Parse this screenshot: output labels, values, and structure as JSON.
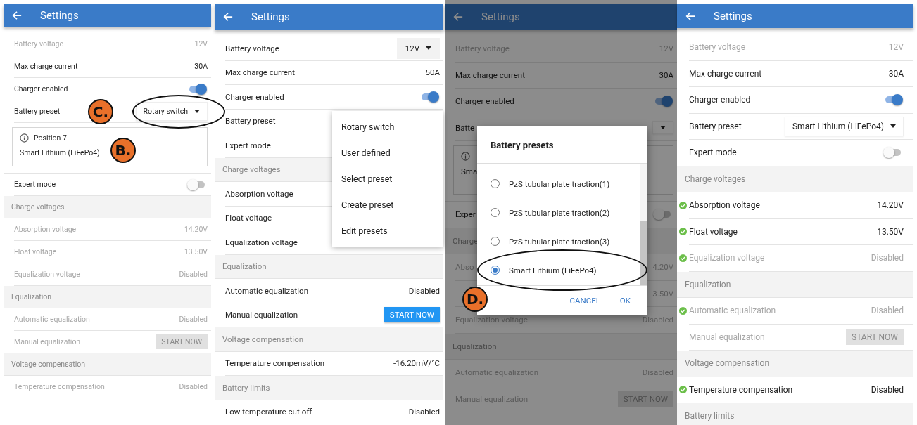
{
  "panels": [
    {
      "title": "Settings",
      "items": [
        {
          "kind": "value",
          "label": "Battery voltage",
          "value": "12V",
          "disabled": true
        },
        {
          "kind": "value",
          "label": "Max charge current",
          "value": "30A"
        },
        {
          "kind": "toggle",
          "label": "Charger enabled",
          "on": true
        },
        {
          "kind": "dropdown",
          "label": "Battery preset",
          "value": "Rotary switch",
          "callout": "C.",
          "circled": true
        },
        {
          "kind": "info",
          "title": "Position 7",
          "text": "Smart Lithium (LiFePo4)",
          "callout": "B."
        },
        {
          "kind": "toggle",
          "label": "Expert mode",
          "on": false
        },
        {
          "kind": "header",
          "label": "Charge voltages"
        },
        {
          "kind": "value",
          "label": "Absorption voltage",
          "value": "14.20V",
          "disabled": true
        },
        {
          "kind": "value",
          "label": "Float voltage",
          "value": "13.50V",
          "disabled": true
        },
        {
          "kind": "value",
          "label": "Equalization voltage",
          "value": "Disabled",
          "disabled": true
        },
        {
          "kind": "header",
          "label": "Equalization"
        },
        {
          "kind": "value",
          "label": "Automatic equalization",
          "value": "Disabled",
          "disabled": true
        },
        {
          "kind": "button",
          "label": "Manual equalization",
          "button": "START NOW",
          "disabled": true
        },
        {
          "kind": "header",
          "label": "Voltage compensation"
        },
        {
          "kind": "value",
          "label": "Temperature compensation",
          "value": "Disabled",
          "disabled": true
        }
      ]
    },
    {
      "title": "Settings",
      "items": [
        {
          "kind": "dropdown",
          "label": "Battery voltage",
          "value": "12V"
        },
        {
          "kind": "value",
          "label": "Max charge current",
          "value": "50A"
        },
        {
          "kind": "toggle",
          "label": "Charger enabled",
          "on": true
        },
        {
          "kind": "value",
          "label": "Battery preset"
        },
        {
          "kind": "value",
          "label": "Expert mode"
        },
        {
          "kind": "header",
          "label": "Charge voltages"
        },
        {
          "kind": "value",
          "label": "Absorption voltage"
        },
        {
          "kind": "value",
          "label": "Float voltage"
        },
        {
          "kind": "value",
          "label": "Equalization voltage"
        },
        {
          "kind": "header",
          "label": "Equalization"
        },
        {
          "kind": "value",
          "label": "Automatic equalization",
          "value": "Disabled"
        },
        {
          "kind": "button",
          "label": "Manual equalization",
          "button": "START NOW",
          "disabled": false
        },
        {
          "kind": "header",
          "label": "Voltage compensation"
        },
        {
          "kind": "value",
          "label": "Temperature compensation",
          "value": "-16.20mV/°C"
        },
        {
          "kind": "header",
          "label": "Battery limits"
        },
        {
          "kind": "value",
          "label": "Low temperature cut-off",
          "value": "Disabled"
        }
      ],
      "menu": [
        "Rotary switch",
        "User defined",
        "Select preset",
        "Create preset",
        "Edit presets"
      ]
    },
    {
      "title": "Settings",
      "items": [
        {
          "kind": "value",
          "label": "Battery voltage",
          "value": "12V",
          "disabled": true
        },
        {
          "kind": "value",
          "label": "Max charge current",
          "value": "30A"
        },
        {
          "kind": "toggle",
          "label": "Charger enabled",
          "on": true
        },
        {
          "kind": "dropdown",
          "label": "Batte"
        },
        {
          "kind": "info",
          "text": "Sma"
        },
        {
          "kind": "toggle",
          "label": "Exper",
          "on": false
        },
        {
          "kind": "header",
          "label": "Charge"
        },
        {
          "kind": "value",
          "label": "Abso",
          "value": "4.20V",
          "disabled": true
        },
        {
          "kind": "value",
          "value": "3.50V",
          "disabled": true
        },
        {
          "kind": "value",
          "label": "Equalization voltage",
          "value": "Disabled",
          "disabled": true
        },
        {
          "kind": "header",
          "label": "Equalization"
        },
        {
          "kind": "value",
          "label": "Automatic equalization",
          "value": "Disabled",
          "disabled": true
        },
        {
          "kind": "button",
          "label": "Manual equalization",
          "button": "START NOW",
          "disabled": true
        }
      ],
      "dialog": {
        "title": "Battery presets",
        "callout": "D.",
        "options": [
          {
            "label": "PzS tubular plate traction(1)",
            "selected": false
          },
          {
            "label": "PzS tubular plate traction(2)",
            "selected": false
          },
          {
            "label": "PzS tubular plate traction(3)",
            "selected": false
          },
          {
            "label": "Smart Lithium (LiFePo4)",
            "selected": true,
            "circled": true
          }
        ],
        "buttons": [
          "CANCEL",
          "OK"
        ]
      }
    },
    {
      "title": "Settings",
      "items": [
        {
          "kind": "value",
          "label": "Battery voltage",
          "value": "12V",
          "disabled": true
        },
        {
          "kind": "value",
          "label": "Max charge current",
          "value": "30A"
        },
        {
          "kind": "toggle",
          "label": "Charger enabled",
          "on": true
        },
        {
          "kind": "dropdown",
          "label": "Battery preset",
          "value": "Smart Lithium (LiFePo4)"
        },
        {
          "kind": "toggle",
          "label": "Expert mode",
          "on": false
        },
        {
          "kind": "header",
          "label": "Charge voltages"
        },
        {
          "kind": "value",
          "label": "Absorption voltage",
          "value": "14.20V",
          "checked": true
        },
        {
          "kind": "value",
          "label": "Float voltage",
          "value": "13.50V",
          "checked": true
        },
        {
          "kind": "value",
          "label": "Equalization voltage",
          "value": "Disabled",
          "disabled": true,
          "checked": true
        },
        {
          "kind": "header",
          "label": "Equalization"
        },
        {
          "kind": "value",
          "label": "Automatic equalization",
          "value": "Disabled",
          "disabled": true,
          "checked": true
        },
        {
          "kind": "button",
          "label": "Manual equalization",
          "button": "START NOW",
          "disabled": true
        },
        {
          "kind": "header",
          "label": "Voltage compensation"
        },
        {
          "kind": "value",
          "label": "Temperature compensation",
          "value": "Disabled",
          "checked": true
        },
        {
          "kind": "header",
          "label": "Battery limits"
        }
      ]
    }
  ]
}
